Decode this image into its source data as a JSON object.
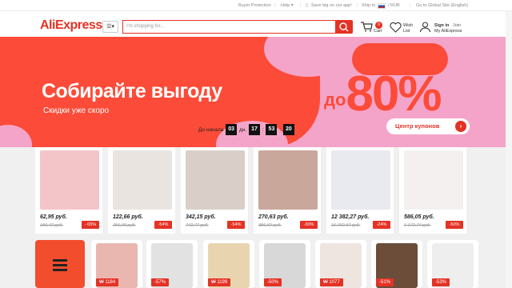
{
  "topbar": {
    "buyer_protection": "Buyer Protection",
    "help": "Help",
    "app_promo": "Save big on our app!",
    "ship_to": "Ship to",
    "currency": "/ RUB",
    "global_site": "Go to Global Site (English)"
  },
  "header": {
    "logo": "AliExpress",
    "category_icon": "menu-icon",
    "search_placeholder": "I'm shopping for...",
    "cart_count": "0",
    "cart_label": "Cart",
    "wish_label_1": "Wish",
    "wish_label_2": "List",
    "signin_label": "Sign in",
    "join_label": "Join",
    "my_ali_label": "My AliExpress"
  },
  "banner": {
    "title": "Собирайте выгоду",
    "subtitle": "Скидки уже скоро",
    "discount_prefix": "до",
    "discount_value": "80%",
    "coupon_label": "Центр купонов",
    "countdown_label": "До начала",
    "countdown_days": "03",
    "countdown_days_label": "дн.",
    "countdown_hours": "17",
    "countdown_minutes": "53",
    "countdown_seconds": "20",
    "colors": {
      "pink": "#f4a4c9",
      "red": "#fc4b38"
    }
  },
  "products": [
    {
      "name": "pastel-panties-pack",
      "price": "62,95 руб.",
      "old": "180,42 руб.",
      "discount": "- 65%",
      "color": "#f3c5c9"
    },
    {
      "name": "black-sports-bra",
      "price": "122,66 руб.",
      "old": "266,09 руб.",
      "discount": "-54%",
      "color": "#e9e4e0"
    },
    {
      "name": "damascus-knife-set",
      "price": "342,15 руб.",
      "old": "742,77 руб.",
      "discount": "-54%",
      "color": "#d9cfc8"
    },
    {
      "name": "slipper-sandals",
      "price": "270,63 руб.",
      "old": "386,60 руб.",
      "discount": "-30%",
      "color": "#c9a79b"
    },
    {
      "name": "lenovo-tab-p11",
      "price": "12 382,27 руб.",
      "old": "16 292,57 руб.",
      "discount": "-24%",
      "color": "#e9eaf0"
    },
    {
      "name": "red-umbrella",
      "price": "586,05 руб.",
      "old": "1 172,74 руб.",
      "discount": "-50%",
      "color": "#f4f0f0"
    }
  ],
  "row2": [
    {
      "name": "promo-tile",
      "tag": "",
      "color": "#f24e2e"
    },
    {
      "name": "phone-case-deal",
      "tag": "₩ 1184",
      "color": "#e9b7b0"
    },
    {
      "name": "sport-sunglasses",
      "tag": "-57%",
      "color": "#e2e2e2"
    },
    {
      "name": "snack-box",
      "tag": "₩ 1199",
      "color": "#e8d5b0"
    },
    {
      "name": "eva-slippers",
      "tag": "-50%",
      "color": "#d8d8d8"
    },
    {
      "name": "hand-tool",
      "tag": "₩ 1077",
      "color": "#efe5e0"
    },
    {
      "name": "dark-gadget",
      "tag": "-51%",
      "color": "#6b4d3a"
    },
    {
      "name": "work-light",
      "tag": "-53%",
      "color": "#eeeeee"
    }
  ]
}
